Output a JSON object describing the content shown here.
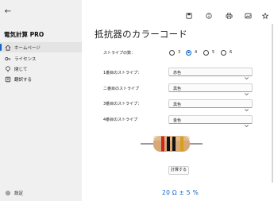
{
  "app": {
    "title": "電気計算 PRO",
    "back_label": "←"
  },
  "nav": {
    "items": [
      {
        "label": "ホームページ",
        "icon": "home-icon",
        "active": true
      },
      {
        "label": "ライセンス",
        "icon": "key-icon",
        "active": false
      },
      {
        "label": "閉じて",
        "icon": "info-icon",
        "active": false
      },
      {
        "label": "翻訳する",
        "icon": "globe-icon",
        "active": false
      }
    ],
    "settings_label": "設定"
  },
  "toolbar": {
    "icons": [
      "save-icon",
      "info-icon",
      "print-icon",
      "image-icon",
      "star-icon"
    ]
  },
  "page": {
    "title": "抵抗器のカラーコード",
    "stripe_count_label": "ストライプの数：",
    "stripe_options": [
      "3",
      "4",
      "5",
      "6"
    ],
    "stripe_selected": "4",
    "rows": [
      {
        "label": "1番目のストライプ：",
        "value": "赤色"
      },
      {
        "label": "二番目のストライプ",
        "value": "黒色"
      },
      {
        "label": "3番目のストライプ：",
        "value": "黒色"
      },
      {
        "label": "4番目のストライプ",
        "value": "金色"
      }
    ],
    "calc_label": "計算する",
    "result": "20 Ω ± 5 %"
  },
  "colors": {
    "accent": "#0a64c8",
    "band_1": "#c62828",
    "band_2": "#111111",
    "band_3": "#111111",
    "band_4": "#d4a017",
    "resistor_body": "#d9a877"
  }
}
